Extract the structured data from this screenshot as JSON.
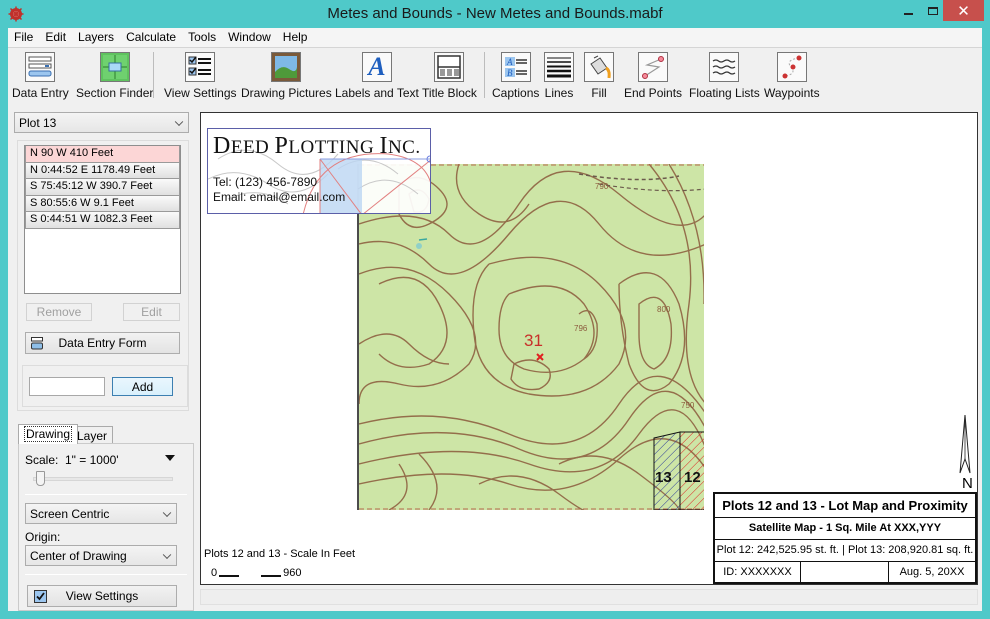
{
  "window": {
    "title": "Metes and Bounds - New Metes and Bounds.mabf",
    "app_icon": "gear-compass-icon",
    "controls": {
      "minimize": "minimize-icon",
      "maximize": "maximize-icon",
      "close": "✕"
    }
  },
  "menu": [
    "File",
    "Edit",
    "Layers",
    "Calculate",
    "Tools",
    "Window",
    "Help"
  ],
  "toolbar": [
    {
      "label": "Data Entry",
      "icon": "data-entry-icon"
    },
    {
      "label": "Section Finder",
      "icon": "section-finder-icon"
    },
    {
      "label": "View Settings",
      "icon": "view-settings-icon"
    },
    {
      "label": "Drawing Pictures",
      "icon": "picture-icon"
    },
    {
      "label": "Labels and Text",
      "icon": "text-icon"
    },
    {
      "label": "Title Block",
      "icon": "title-block-icon"
    },
    {
      "label": "Captions",
      "icon": "captions-icon"
    },
    {
      "label": "Lines",
      "icon": "lines-icon"
    },
    {
      "label": "Fill",
      "icon": "paint-bucket-icon"
    },
    {
      "label": "End Points",
      "icon": "end-points-icon"
    },
    {
      "label": "Floating Lists",
      "icon": "floating-lists-icon"
    },
    {
      "label": "Waypoints",
      "icon": "waypoints-icon"
    }
  ],
  "left_panel": {
    "plot_select": "Plot 13",
    "calls": [
      "N 90 W 410 Feet",
      "N 0:44:52 E 1178.49 Feet",
      "S 75:45:12 W 390.7 Feet",
      "S 80:55:6 W 9.1 Feet",
      "S 0:44:51 W 1082.3 Feet"
    ],
    "selected_call_index": 0,
    "remove_label": "Remove",
    "edit_label": "Edit",
    "data_entry_form_label": "Data Entry Form",
    "add_input_value": "",
    "add_label": "Add",
    "tabs": [
      "Drawing",
      "Layer"
    ],
    "active_tab": "Drawing",
    "scale_label": "Scale:",
    "scale_value": "1\" = 1000'",
    "scale_slider_fraction": 0.02,
    "view_mode_select": "Screen Centric",
    "origin_label": "Origin:",
    "origin_select": "Center of Drawing",
    "view_settings_label": "View Settings",
    "view_settings_checked": true
  },
  "canvas": {
    "logo": {
      "title_parts": [
        {
          "big": "D",
          "small": "EED "
        },
        {
          "big": "P",
          "small": "LOTTING "
        },
        {
          "big": "I",
          "small": "NC."
        }
      ],
      "tel": "Tel: (123) 456-7890",
      "email": "Email: email@email.com"
    },
    "map": {
      "section_label": "31",
      "contour_labels": [
        "790",
        "796",
        "800",
        "750"
      ],
      "plots": [
        {
          "label": "13",
          "hatch_color": "#2b3a9a"
        },
        {
          "label": "12",
          "hatch_color": "#e02020"
        }
      ]
    },
    "north_label": "N",
    "title_block": {
      "title": "Plots 12 and 13 - Lot Map and Proximity",
      "subtitle": "Satellite Map - 1 Sq. Mile At XXX,YYY",
      "areas": "Plot 12: 242,525.95 st. ft.  |  Plot 13: 208,920.81 sq. ft.",
      "id": "ID:  XXXXXXX",
      "middle": "",
      "date": "Aug. 5, 20XX"
    },
    "scale_caption": "Plots 12 and 13 - Scale In Feet",
    "scale_start": "0",
    "scale_end": "960"
  },
  "colors": {
    "titlebar": "#4fc9c9",
    "close_button": "#c7504c",
    "map_fill": "#cde5a6",
    "contour": "#8b5a3c",
    "selected_row": "#fcd6d6"
  }
}
